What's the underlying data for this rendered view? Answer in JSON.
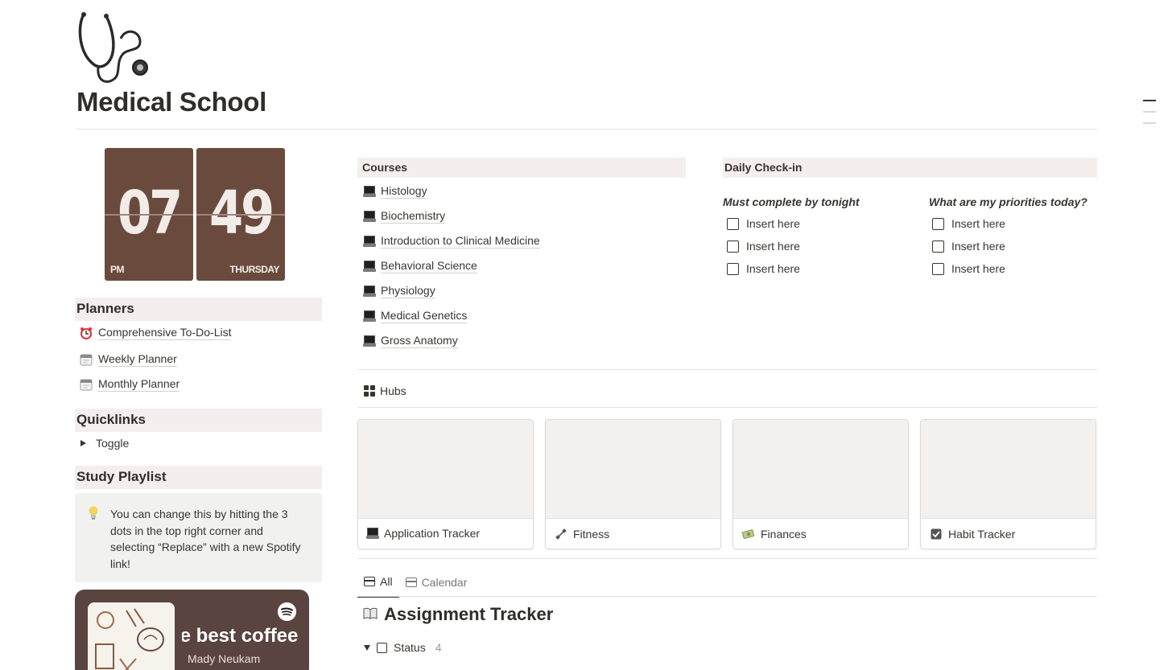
{
  "page": {
    "title": "Medical School",
    "icon": "stethoscope-icon"
  },
  "clock": {
    "hour": "07",
    "minute": "49",
    "period": "PM",
    "day": "THURSDAY",
    "color": "#6b4a3e"
  },
  "planners": {
    "title": "Planners",
    "items": [
      {
        "label": "Comprehensive To-Do-List",
        "icon": "alarm-clock-icon"
      },
      {
        "label": "Weekly Planner",
        "icon": "calendar-icon"
      },
      {
        "label": "Monthly Planner",
        "icon": "calendar-icon"
      }
    ]
  },
  "quicklinks": {
    "title": "Quicklinks",
    "toggle_label": "Toggle"
  },
  "playlist": {
    "title": "Study Playlist",
    "callout": "You can change this by hitting the 3 dots in the top right corner and selecting “Replace” with a new Spotify link!",
    "song": "he best coffee",
    "artist": "Mady Neukam"
  },
  "courses": {
    "title": "Courses",
    "items": [
      "Histology",
      "Biochemistry",
      "Introduction to Clinical Medicine",
      "Behavioral Science",
      "Physiology",
      "Medical Genetics",
      "Gross Anatomy"
    ]
  },
  "checkin": {
    "title": "Daily Check-in",
    "left_label": "Must complete by tonight",
    "right_label": "What are my priorities today?",
    "left_items": [
      "Insert here",
      "Insert here",
      "Insert here"
    ],
    "right_items": [
      "Insert here",
      "Insert here",
      "Insert here"
    ]
  },
  "hubs": {
    "title": "Hubs",
    "cards": [
      {
        "label": "Application Tracker",
        "icon": "laptop-icon"
      },
      {
        "label": "Fitness",
        "icon": "dumbbell-icon"
      },
      {
        "label": "Finances",
        "icon": "money-icon"
      },
      {
        "label": "Habit Tracker",
        "icon": "checkbox-icon"
      }
    ]
  },
  "tracker": {
    "tabs": [
      "All",
      "Calendar"
    ],
    "title": "Assignment Tracker",
    "group_label": "Status",
    "group_count": "4"
  }
}
